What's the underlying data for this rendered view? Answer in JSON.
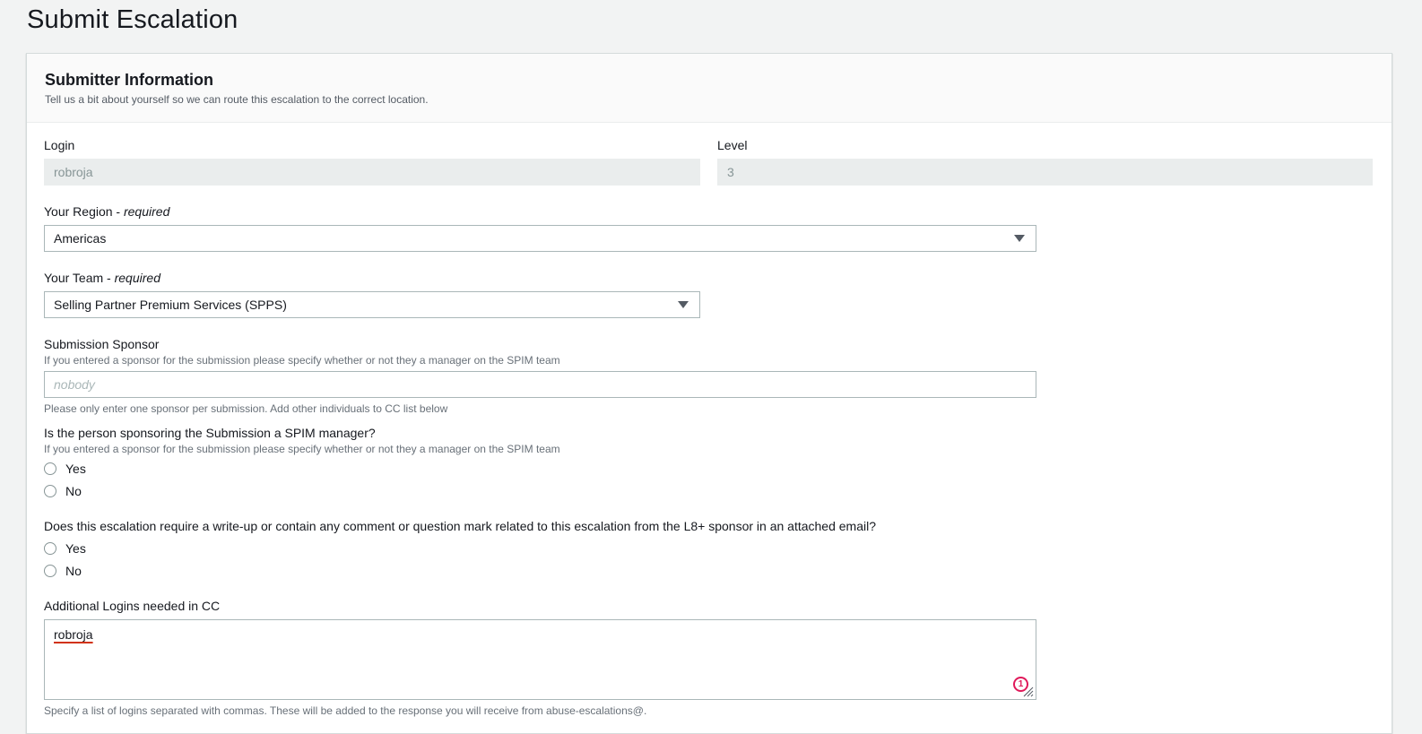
{
  "page": {
    "title": "Submit Escalation"
  },
  "panel": {
    "title": "Submitter Information",
    "description": "Tell us a bit about yourself so we can route this escalation to the correct location."
  },
  "login": {
    "label": "Login",
    "value": "robroja"
  },
  "level": {
    "label": "Level",
    "value": "3"
  },
  "region": {
    "label": "Your Region - ",
    "required": "required",
    "value": "Americas"
  },
  "team": {
    "label": "Your Team - ",
    "required": "required",
    "value": "Selling Partner Premium Services (SPPS)"
  },
  "sponsor": {
    "label": "Submission Sponsor",
    "hint": "If you entered a sponsor for the submission please specify whether or not they a manager on the SPIM team",
    "placeholder": "nobody",
    "footnote": "Please only enter one sponsor per submission. Add other individuals to CC list below"
  },
  "spim_manager": {
    "question": "Is the person sponsoring the Submission a SPIM manager?",
    "hint": "If you entered a sponsor for the submission please specify whether or not they a manager on the SPIM team",
    "options": [
      "Yes",
      "No"
    ]
  },
  "writeup": {
    "question": "Does this escalation require a write-up or contain any comment or question mark related to this escalation from the L8+ sponsor in an attached email?",
    "options": [
      "Yes",
      "No"
    ]
  },
  "cc": {
    "label": "Additional Logins needed in CC",
    "value": "robroja",
    "badge_count": "1",
    "footnote": "Specify a list of logins separated with commas. These will be added to the response you will receive from abuse-escalations@."
  },
  "colors": {
    "background": "#f2f3f3",
    "panel": "#ffffff",
    "disabled_input": "#eaeded",
    "badge": "#e0195a",
    "spellcheck": "#d13212"
  }
}
